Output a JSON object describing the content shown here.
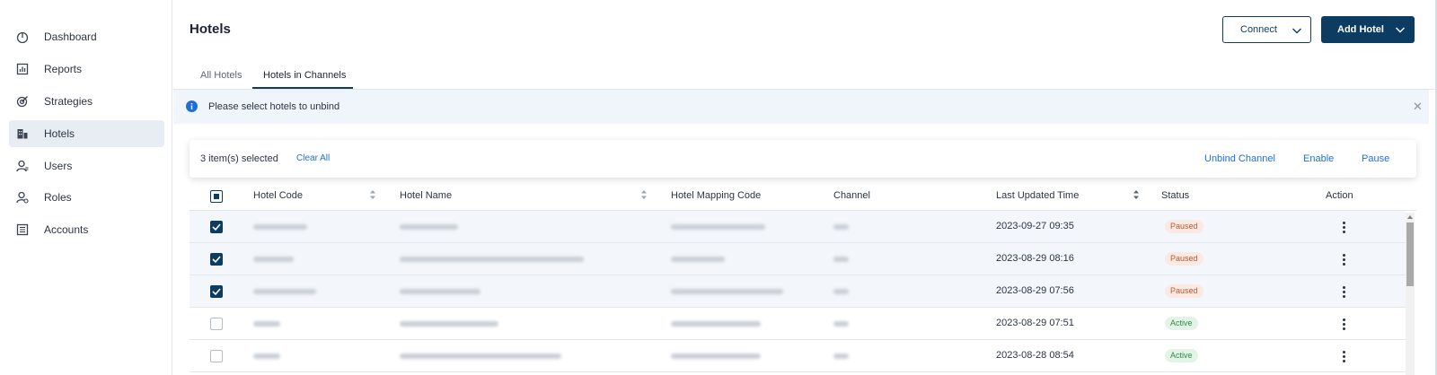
{
  "sidebar": {
    "items": [
      {
        "label": "Dashboard",
        "icon": "dashboard-icon"
      },
      {
        "label": "Reports",
        "icon": "reports-icon"
      },
      {
        "label": "Strategies",
        "icon": "strategies-icon"
      },
      {
        "label": "Hotels",
        "icon": "hotels-icon",
        "active": true
      },
      {
        "label": "Users",
        "icon": "users-icon"
      },
      {
        "label": "Roles",
        "icon": "roles-icon"
      },
      {
        "label": "Accounts",
        "icon": "accounts-icon"
      }
    ]
  },
  "header": {
    "title": "Hotels",
    "connect_label": "Connect",
    "add_hotel_label": "Add Hotel"
  },
  "tabs": [
    "All Hotels",
    "Hotels in Channels"
  ],
  "banner": {
    "message": "Please select hotels to unbind"
  },
  "selection": {
    "count_text": "3 item(s) selected",
    "clear_label": "Clear All",
    "actions": [
      "Unbind Channel",
      "Enable",
      "Pause"
    ]
  },
  "table": {
    "columns": [
      "Hotel Code",
      "Hotel Name",
      "Hotel Mapping Code",
      "Channel",
      "Last Updated Time",
      "Status",
      "Action"
    ],
    "rows": [
      {
        "selected": true,
        "time": "2023-09-27 09:35",
        "status": "Paused"
      },
      {
        "selected": true,
        "time": "2023-08-29 08:16",
        "status": "Paused"
      },
      {
        "selected": true,
        "time": "2023-08-29 07:56",
        "status": "Paused"
      },
      {
        "selected": false,
        "time": "2023-08-29 07:51",
        "status": "Active"
      },
      {
        "selected": false,
        "time": "2023-08-28 08:54",
        "status": "Active"
      }
    ]
  },
  "colors": {
    "primary": "#0d3c63",
    "link": "#1f6fd1",
    "paused_bg": "#fbeae3",
    "active_bg": "#e3f4e6"
  }
}
